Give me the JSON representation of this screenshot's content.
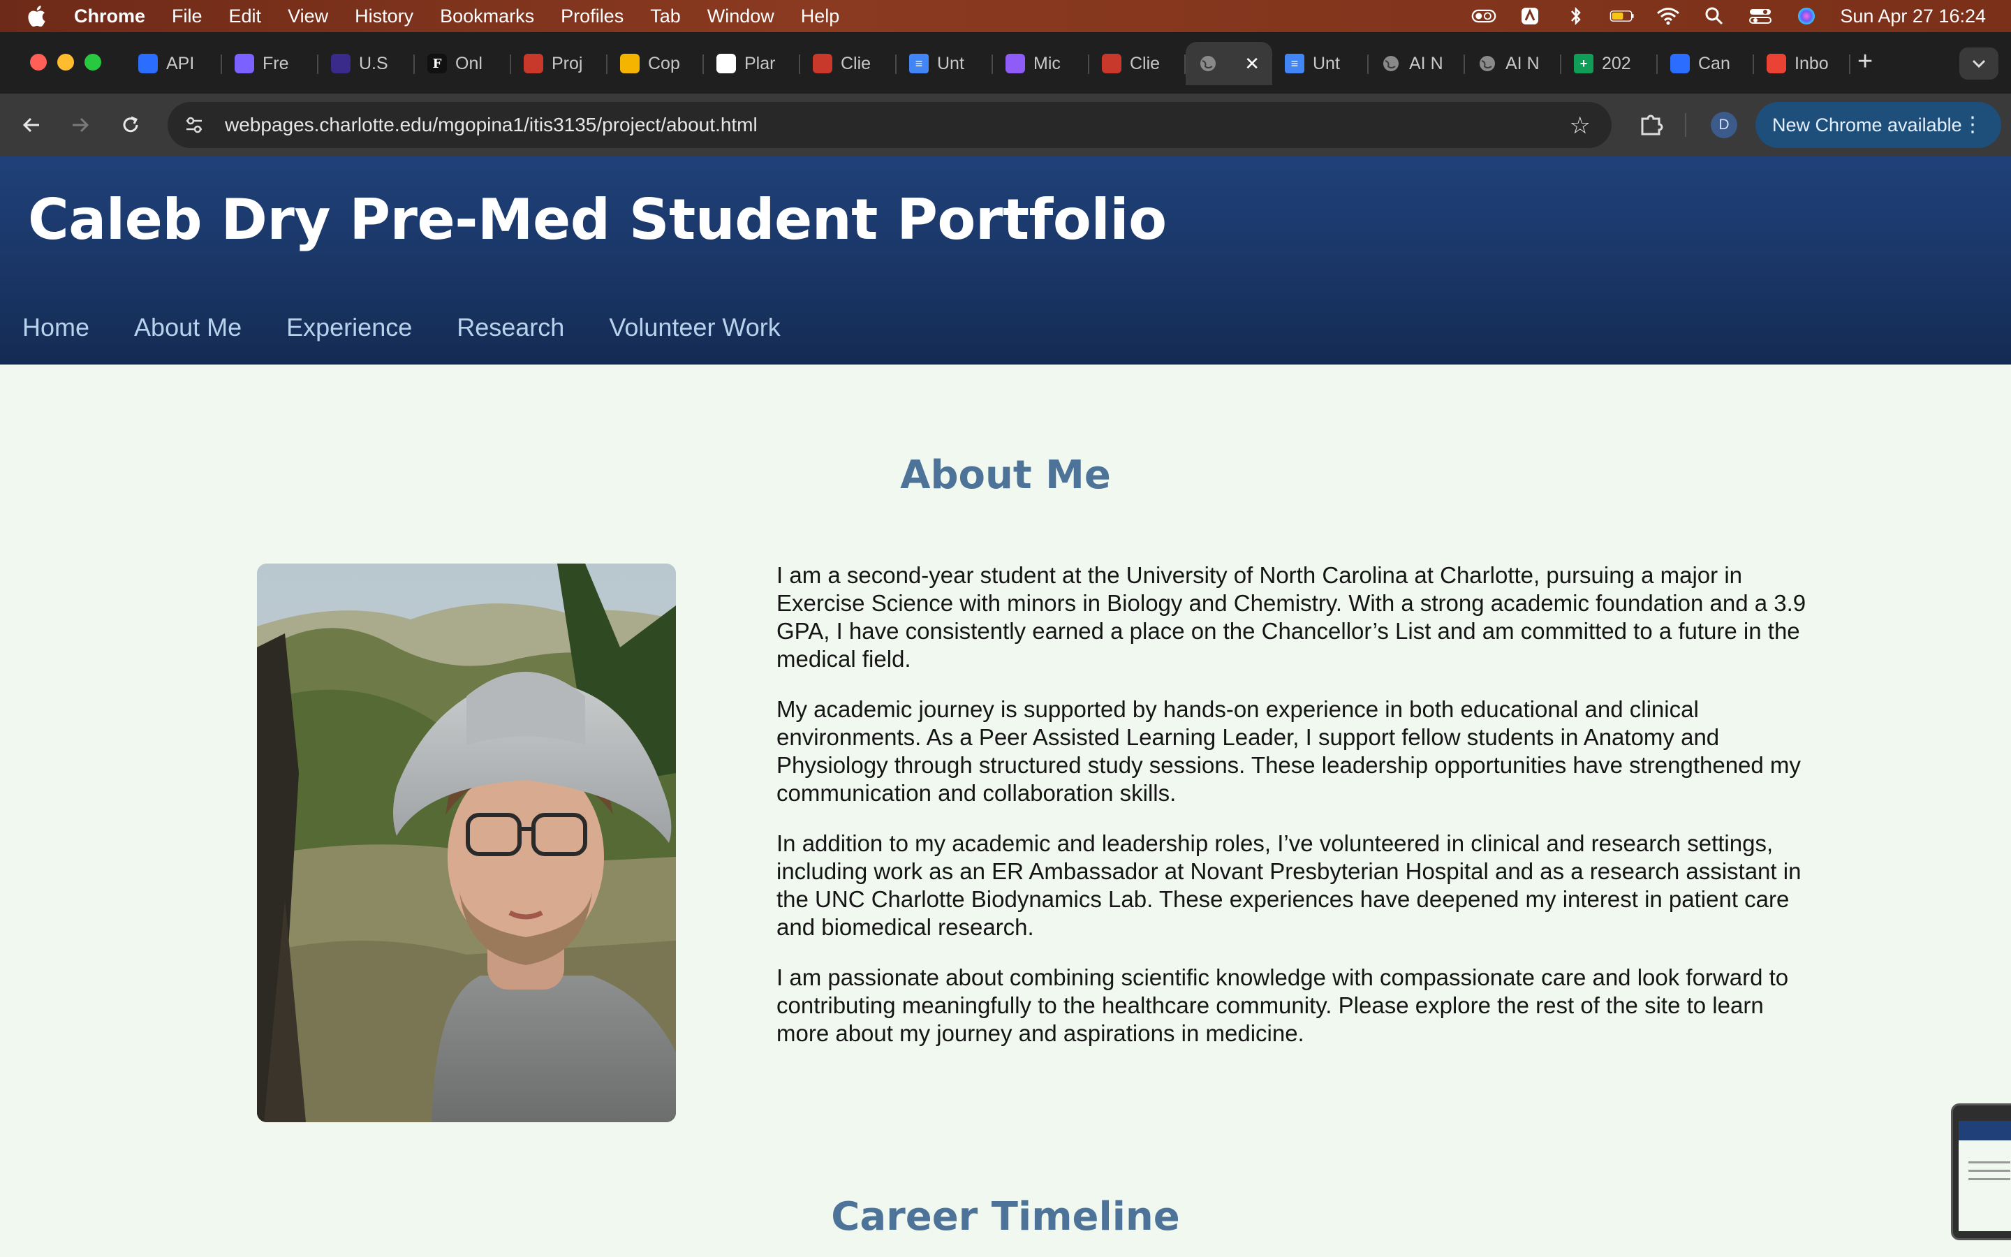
{
  "menubar": {
    "app_name": "Chrome",
    "items": [
      "File",
      "Edit",
      "View",
      "History",
      "Bookmarks",
      "Profiles",
      "Tab",
      "Window",
      "Help"
    ],
    "status_icons": [
      "control-center-icon",
      "security-icon",
      "bluetooth-icon",
      "battery-icon",
      "wifi-icon",
      "spotlight-search-icon",
      "controls-icon",
      "siri-icon"
    ],
    "clock": "Sun Apr 27  16:24"
  },
  "browser": {
    "tabs": [
      {
        "label": "API",
        "icon": "openai-icon",
        "color": "#2a6dff"
      },
      {
        "label": "Fre",
        "icon": "layers-icon",
        "color": "#7b61ff"
      },
      {
        "label": "U.S",
        "icon": "flag-icon",
        "color": "#3a2a8a"
      },
      {
        "label": "Onl",
        "icon": "letter-f-icon",
        "color": "#111111"
      },
      {
        "label": "Proj",
        "icon": "gear-logo-icon",
        "color": "#c8392b"
      },
      {
        "label": "Cop",
        "icon": "slides-icon",
        "color": "#f4b400"
      },
      {
        "label": "Plar",
        "icon": "openai-icon",
        "color": "#ffffff"
      },
      {
        "label": "Clie",
        "icon": "gear-logo-icon",
        "color": "#c8392b"
      },
      {
        "label": "Unt",
        "icon": "docs-icon",
        "color": "#4285f4"
      },
      {
        "label": "Mic",
        "icon": "copilot-icon",
        "color": "#8f5cf7"
      },
      {
        "label": "Clie",
        "icon": "gear-logo-icon",
        "color": "#c8392b"
      },
      {
        "label": "",
        "icon": "globe-icon",
        "color": "#9a9a9a",
        "active": true
      },
      {
        "label": "Unt",
        "icon": "docs-icon",
        "color": "#4285f4"
      },
      {
        "label": "AI N",
        "icon": "globe-icon",
        "color": "#9a9a9a"
      },
      {
        "label": "AI N",
        "icon": "globe-icon",
        "color": "#9a9a9a"
      },
      {
        "label": "202",
        "icon": "sheets-icon",
        "color": "#0f9d58"
      },
      {
        "label": "Can",
        "icon": "canvas-icon",
        "color": "#2a6dff"
      },
      {
        "label": "Inbo",
        "icon": "gmail-icon",
        "color": "#ea4335"
      }
    ],
    "url": "webpages.charlotte.edu/mgopina1/itis3135/project/about.html",
    "profile_initial": "D",
    "update_label": "New Chrome available"
  },
  "site": {
    "title": "Caleb Dry Pre-Med Student Portfolio",
    "nav": [
      "Home",
      "About Me",
      "Experience",
      "Research",
      "Volunteer Work"
    ],
    "about_heading": "About Me",
    "bio": [
      "I am a second-year student at the University of North Carolina at Charlotte, pursuing a major in Exercise Science with minors in Biology and Chemistry. With a strong academic foundation and a 3.9 GPA, I have consistently earned a place on the Chancellor’s List and am committed to a future in the medical field.",
      "My academic journey is supported by hands-on experience in both educational and clinical environments. As a Peer Assisted Learning Leader, I support fellow students in Anatomy and Physiology through structured study sessions. These leadership opportunities have strengthened my communication and collaboration skills.",
      "In addition to my academic and leadership roles, I’ve volunteered in clinical and research settings, including work as an ER Ambassador at Novant Presbyterian Hospital and as a research assistant in the UNC Charlotte Biodynamics Lab. These experiences have deepened my interest in patient care and biomedical research.",
      "I am passionate about combining scientific knowledge with compassionate care and look forward to contributing meaningfully to the healthcare community. Please explore the rest of the site to learn more about my journey and aspirations in medicine."
    ],
    "career_heading": "Career Timeline"
  },
  "colors": {
    "header_bg": "#1a3666",
    "nav_link": "#b9d2ec",
    "heading": "#4d7398",
    "page_bg": "#f1f8ef"
  }
}
